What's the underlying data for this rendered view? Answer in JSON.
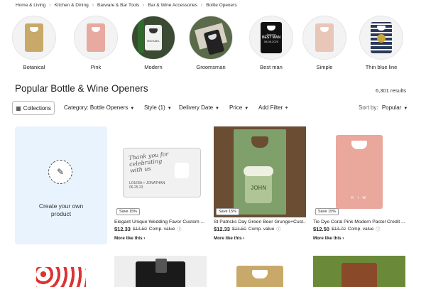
{
  "breadcrumb": [
    "Home & Living",
    "Kitchen & Dining",
    "Barware & Bar Tools",
    "Bar & Wine Accessories",
    "Bottle Openers"
  ],
  "categories": [
    {
      "label": "Botanical",
      "color": "#c9a96a"
    },
    {
      "label": "Pink",
      "color": "#e7a9a0"
    },
    {
      "label": "Modern",
      "color": "#2f3a2a"
    },
    {
      "label": "Groomsman",
      "color": "#39463a"
    },
    {
      "label": "Best man",
      "color": "#1a1a1a"
    },
    {
      "label": "Simple",
      "color": "#e8c6b8"
    },
    {
      "label": "Thin blue line",
      "color": "#2b3a5a"
    }
  ],
  "header": {
    "title": "Popular Bottle & Wine Openers",
    "results": "6,301 results"
  },
  "filters": {
    "collections": "Collections",
    "category": "Category: Bottle Openers",
    "style": "Style (1)",
    "delivery": "Delivery Date",
    "price": "Price",
    "add_filter": "Add Filter",
    "sort_label": "Sort by:",
    "sort_value": "Popular"
  },
  "create": {
    "text_line1": "Create your own",
    "text_line2": "product"
  },
  "products": [
    {
      "name": "Elegant Unique Wedding Favor Custom ...",
      "price": "$12.33",
      "old_price": "$14.50",
      "comp": "Comp. value",
      "badge": "Save 15%",
      "more": "More like this",
      "card_text_1": "Thank you for",
      "card_text_2": "celebrating",
      "card_text_3": "with us",
      "card_names": "LOUISA + JONATHAN",
      "card_date": "06.25.23"
    },
    {
      "name": "St Patricks Day Green Beer Grunge+Cust...",
      "price": "$12.33",
      "old_price": "$14.50",
      "comp": "Comp. value",
      "badge": "Save 15%",
      "more": "More like this",
      "card_name": "JOHN"
    },
    {
      "name": "Tie Dye Coral Pink Modern Pastel Credit ...",
      "price": "$12.50",
      "old_price": "$14.70",
      "comp": "Comp. value",
      "badge": "Save 15%",
      "more": "More like this",
      "monogram": "K I W"
    }
  ],
  "category_details": {
    "modern_text": "MICHAEL",
    "bestman_1": "Antonio",
    "bestman_2": "BEST MAN",
    "bestman_3": "08.08.2025"
  }
}
